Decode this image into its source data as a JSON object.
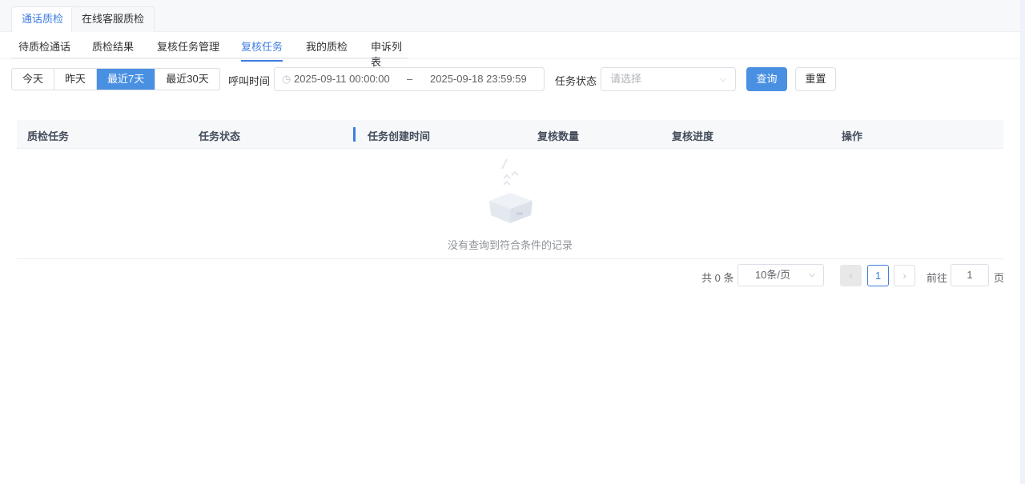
{
  "top_tabs": [
    "通话质检",
    "在线客服质检"
  ],
  "sub_tabs": [
    "待质检通话",
    "质检结果",
    "复核任务管理",
    "复核任务",
    "我的质检",
    "申诉列表"
  ],
  "quick_dates": [
    "今天",
    "昨天",
    "最近7天",
    "最近30天"
  ],
  "filters": {
    "call_time_label": "呼叫时间",
    "start": "2025-09-11 00:00:00",
    "sep": "–",
    "end": "2025-09-18 23:59:59",
    "status_label": "任务状态",
    "status_placeholder": "请选择",
    "query": "查询",
    "reset": "重置"
  },
  "table": {
    "columns": [
      "质检任务",
      "任务状态",
      "任务创建时间",
      "复核数量",
      "复核进度",
      "操作"
    ],
    "empty": "没有查询到符合条件的记录"
  },
  "pagination": {
    "total": "共 0 条",
    "page_size": "10条/页",
    "current": "1",
    "goto_label": "前往",
    "goto_value": "1",
    "page_suffix": "页"
  },
  "colors": {
    "accent": "#3e7de0",
    "primary_button": "#4a90e2"
  }
}
